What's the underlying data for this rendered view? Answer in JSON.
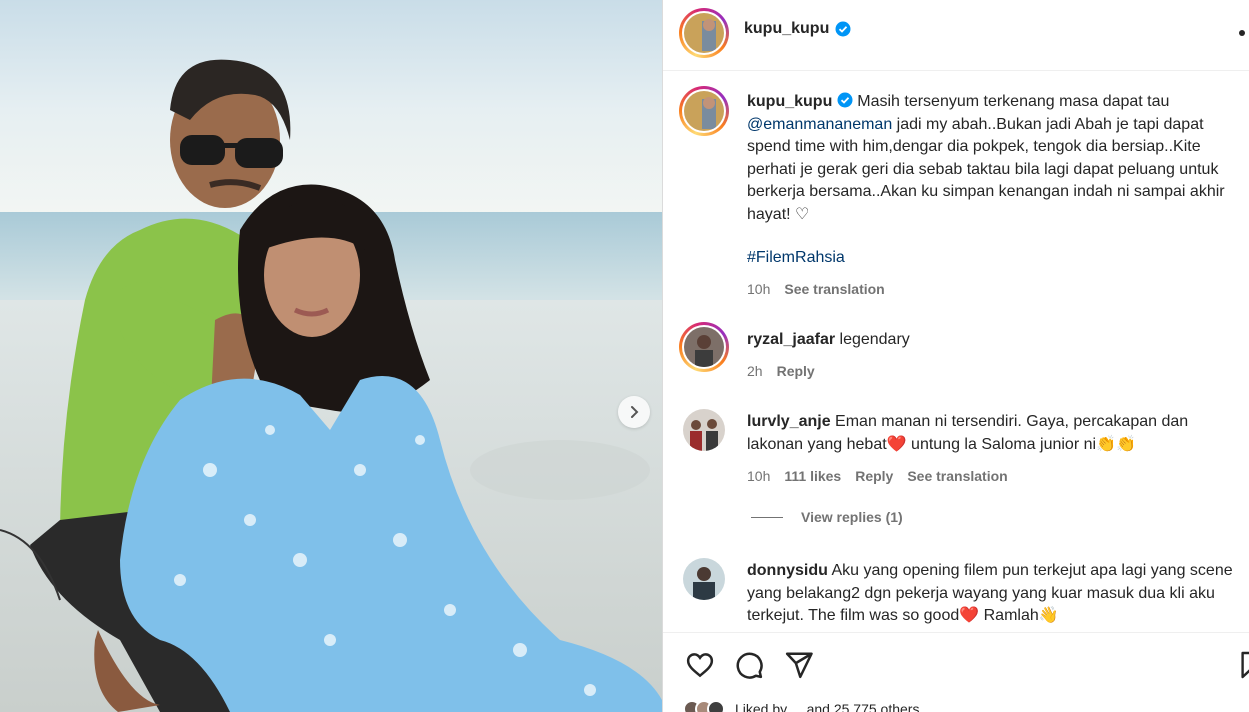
{
  "post": {
    "owner": "kupu_kupu",
    "caption_text": " Masih tersenyum terkenang masa dapat tau ",
    "caption_mention": "@emanmananeman",
    "caption_rest": " jadi my abah..Bukan jadi Abah je tapi dapat spend time with him,dengar dia pokpek, tengok dia bersiap..Kite perhati je gerak geri dia sebab taktau bila lagi dapat peluang untuk berkerja bersama..Akan ku simpan kenangan indah ni sampai akhir hayat! ♡",
    "hashtag": "#FilemRahsia",
    "time": "10h",
    "see_translation": "See translation"
  },
  "comments": [
    {
      "user": "ryzal_jaafar",
      "text": " legendary",
      "time": "2h",
      "reply": "Reply"
    },
    {
      "user": "lurvly_anje",
      "text": " Eman manan ni tersendiri. Gaya, percakapan dan lakonan yang hebat❤️ untung la Saloma junior ni👏👏",
      "time": "10h",
      "likes": "111 likes",
      "reply": "Reply",
      "see_translation": "See translation",
      "view_replies": "View replies (1)"
    },
    {
      "user": "donnysidu",
      "text": " Aku yang opening filem pun terkejut apa lagi yang scene yang belakang2 dgn pekerja wayang yang kuar masuk dua kli aku terkejut. The film was so good❤️ Ramlah👋"
    }
  ],
  "likes_line": "Liked by ... and 25,775 others",
  "colors": {
    "link": "#00376b",
    "meta": "#737373",
    "verified": "#0095f6"
  },
  "icons": [
    "verified-icon",
    "more-icon",
    "next-arrow-icon",
    "heart-icon",
    "comment-icon",
    "share-icon",
    "bookmark-icon",
    "like-heart-icon"
  ]
}
